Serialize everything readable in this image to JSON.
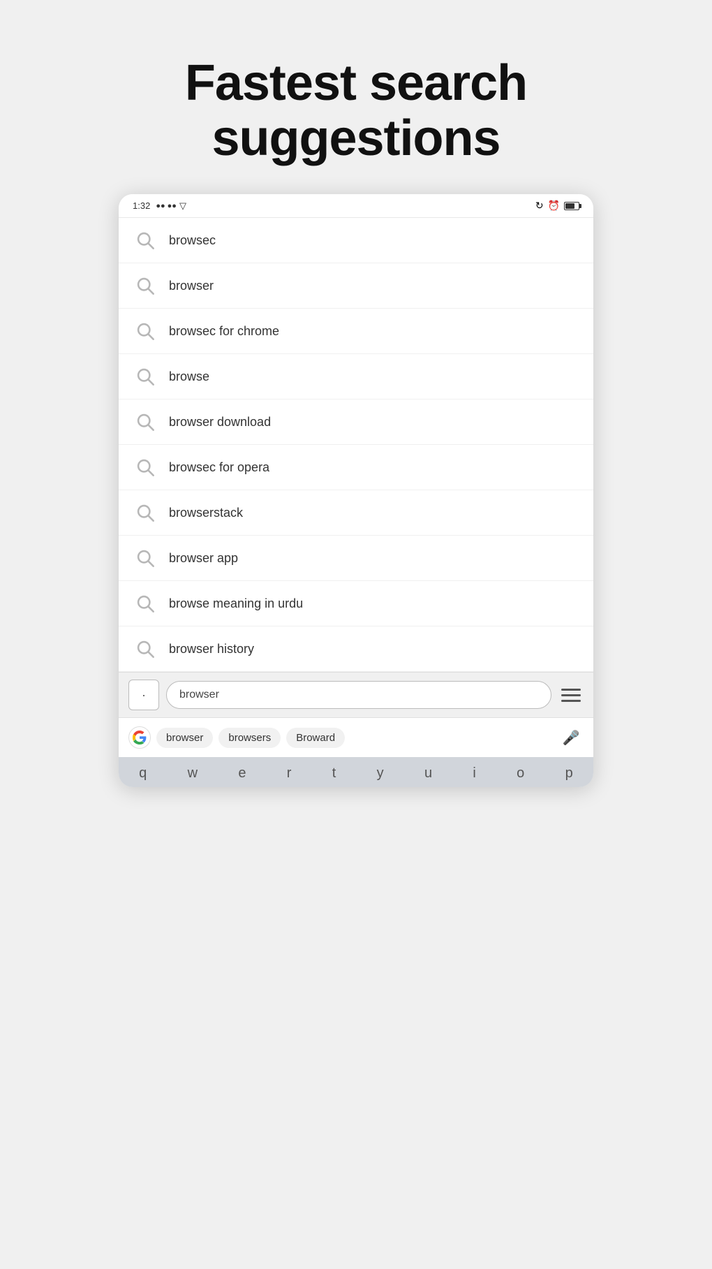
{
  "promo": {
    "title": "Fastest search suggestions"
  },
  "statusBar": {
    "time": "1:32",
    "signalBars": "●● ●●",
    "wifi": "▽"
  },
  "suggestions": [
    {
      "text": "browsec"
    },
    {
      "text": "browser"
    },
    {
      "text": "browsec for chrome"
    },
    {
      "text": "browse"
    },
    {
      "text": "browser download"
    },
    {
      "text": "browsec for opera"
    },
    {
      "text": "browserstack"
    },
    {
      "text": "browser app"
    },
    {
      "text": "browse meaning in urdu"
    },
    {
      "text": "browser history"
    }
  ],
  "searchBar": {
    "squareLabel": "·",
    "inputText": "browser",
    "menuLabel": "≡"
  },
  "suggestionsToolbar": {
    "chips": [
      "browser",
      "browsers",
      "Broward"
    ],
    "micLabel": "🎤"
  },
  "keyboard": {
    "keys": [
      "q",
      "w",
      "e",
      "r",
      "t",
      "y",
      "u",
      "i",
      "o",
      "p"
    ]
  }
}
